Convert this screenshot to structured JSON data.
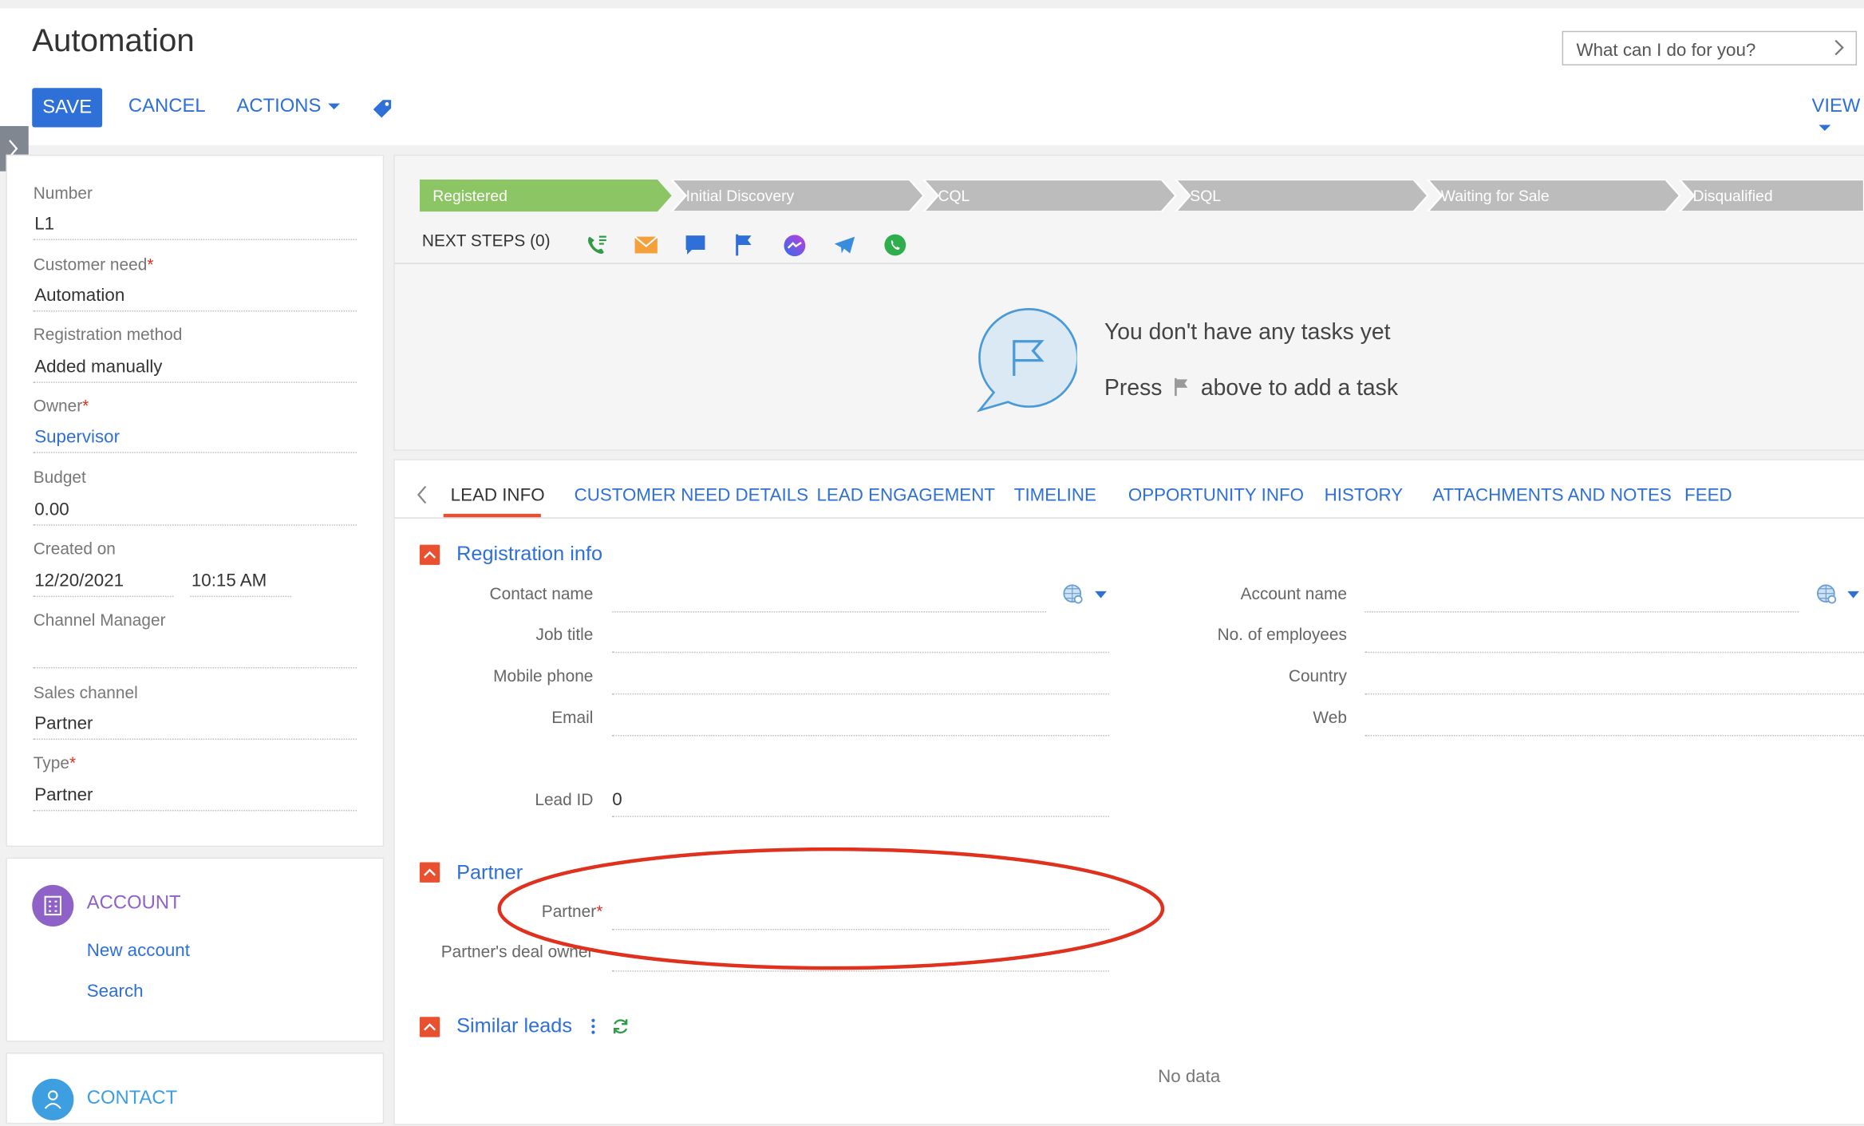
{
  "header": {
    "title": "Automation",
    "save_label": "SAVE",
    "cancel_label": "CANCEL",
    "actions_label": "ACTIONS",
    "view_label": "VIEW",
    "search_placeholder": "What can I do for you?"
  },
  "fields": {
    "number": {
      "label": "Number",
      "value": "L1"
    },
    "customer_need": {
      "label": "Customer need",
      "value": "Automation"
    },
    "registration_method": {
      "label": "Registration method",
      "value": "Added manually"
    },
    "owner": {
      "label": "Owner",
      "value": "Supervisor"
    },
    "budget": {
      "label": "Budget",
      "value": "0.00"
    },
    "created_on": {
      "label": "Created on",
      "date": "12/20/2021",
      "time": "10:15 AM"
    },
    "channel_manager": {
      "label": "Channel Manager",
      "value": ""
    },
    "sales_channel": {
      "label": "Sales channel",
      "value": "Partner"
    },
    "type": {
      "label": "Type",
      "value": "Partner"
    }
  },
  "account_block": {
    "title": "ACCOUNT",
    "new_link": "New account",
    "search_link": "Search"
  },
  "contact_block": {
    "title": "CONTACT"
  },
  "stages": [
    "Registered",
    "Initial Discovery",
    "CQL",
    "SQL",
    "Waiting for Sale",
    "Disqualified"
  ],
  "next_steps": {
    "label": "NEXT STEPS (0)",
    "empty_title": "You don't have any tasks yet",
    "empty_hint_before": "Press",
    "empty_hint_after": "above to add a task"
  },
  "tabs": [
    "LEAD INFO",
    "CUSTOMER NEED DETAILS",
    "LEAD ENGAGEMENT",
    "TIMELINE",
    "OPPORTUNITY INFO",
    "HISTORY",
    "ATTACHMENTS AND NOTES",
    "FEED"
  ],
  "registration_info": {
    "title": "Registration info",
    "contact_name": "Contact name",
    "job_title": "Job title",
    "mobile_phone": "Mobile phone",
    "email": "Email",
    "account_name": "Account name",
    "no_of_employees": "No. of employees",
    "country": "Country",
    "web": "Web",
    "lead_id_label": "Lead ID",
    "lead_id_value": "0"
  },
  "partner_section": {
    "title": "Partner",
    "partner_label": "Partner",
    "deal_owner_label": "Partner's deal owner"
  },
  "similar_leads": {
    "title": "Similar leads",
    "empty": "No data"
  },
  "colors": {
    "accent": "#2e6fd8",
    "stage_active": "#8cc563",
    "stage_inactive": "#bcbcbc",
    "section_toggle": "#e8502f",
    "annotation": "#e0301e"
  }
}
